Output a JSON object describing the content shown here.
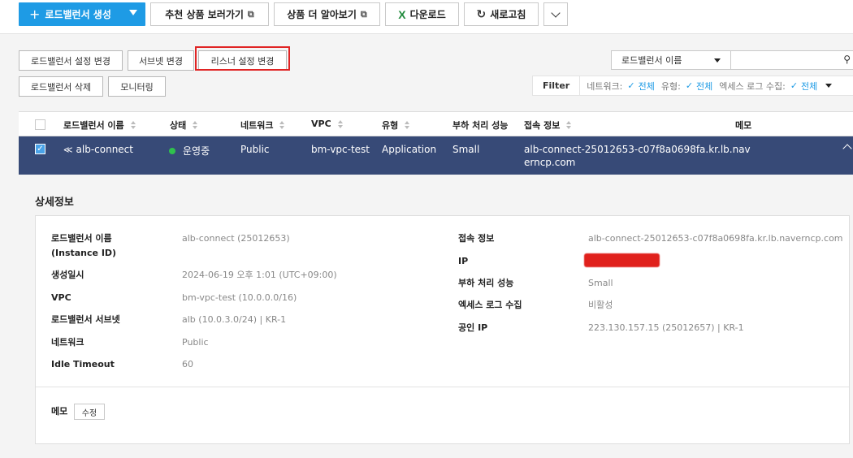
{
  "toolbar": {
    "create_label": "로드밸런서 생성",
    "recommend_label": "추천 상품 보러가기",
    "learn_label": "상품 더 알아보기",
    "download_label": "다운로드",
    "refresh_label": "새로고침"
  },
  "actions": {
    "lb_settings": "로드밸런서 설정 변경",
    "subnet_change": "서브넷 변경",
    "listener_settings": "리스너 설정 변경",
    "delete": "로드밸런서 삭제",
    "monitoring": "모니터링"
  },
  "search": {
    "select_value": "로드밸런서 이름",
    "input_value": ""
  },
  "filter": {
    "label": "Filter",
    "items": [
      {
        "name": "네트워크:",
        "value": "전체"
      },
      {
        "name": "유형:",
        "value": "전체"
      },
      {
        "name": "엑세스 로그 수집:",
        "value": "전체"
      }
    ]
  },
  "table": {
    "headers": [
      "로드밸런서 이름",
      "상태",
      "네트워크",
      "VPC",
      "유형",
      "부하 처리 성능",
      "접속 정보",
      "메모"
    ],
    "row": {
      "name": "alb-connect",
      "status": "운영중",
      "network": "Public",
      "vpc": "bm-vpc-test",
      "type": "Application",
      "performance": "Small",
      "endpoint_line1": "alb-connect-25012653-c07f8a0698fa.kr.lb.nav",
      "endpoint_line2": "erncp.com"
    }
  },
  "detail": {
    "title": "상세정보",
    "left": [
      {
        "label": "로드밸런서 이름",
        "label2": "(Instance ID)",
        "value": "alb-connect (25012653)"
      },
      {
        "label": "생성일시",
        "value": "2024-06-19 오후 1:01 (UTC+09:00)"
      },
      {
        "label": "VPC",
        "value": "bm-vpc-test (10.0.0.0/16)"
      },
      {
        "label": "로드밸런서 서브넷",
        "value": "alb (10.0.3.0/24) | KR-1"
      },
      {
        "label": "네트워크",
        "value": "Public"
      },
      {
        "label": "Idle Timeout",
        "value": "60"
      }
    ],
    "right": [
      {
        "label": "접속 정보",
        "value": "alb-connect-25012653-c07f8a0698fa.kr.lb.naverncp.com"
      },
      {
        "label": "IP",
        "value": ""
      },
      {
        "label": "부하 처리 성능",
        "value": "Small"
      },
      {
        "label": "엑세스 로그 수집",
        "value": "비활성"
      },
      {
        "label": "공인 IP",
        "value": "223.130.157.15 (25012657) | KR-1"
      }
    ],
    "memo_label": "메모",
    "memo_edit": "수정"
  },
  "colors": {
    "primary": "#1e9be5",
    "selected_row": "#374a77",
    "status_running": "#2fc14d",
    "highlight": "#e02424"
  }
}
